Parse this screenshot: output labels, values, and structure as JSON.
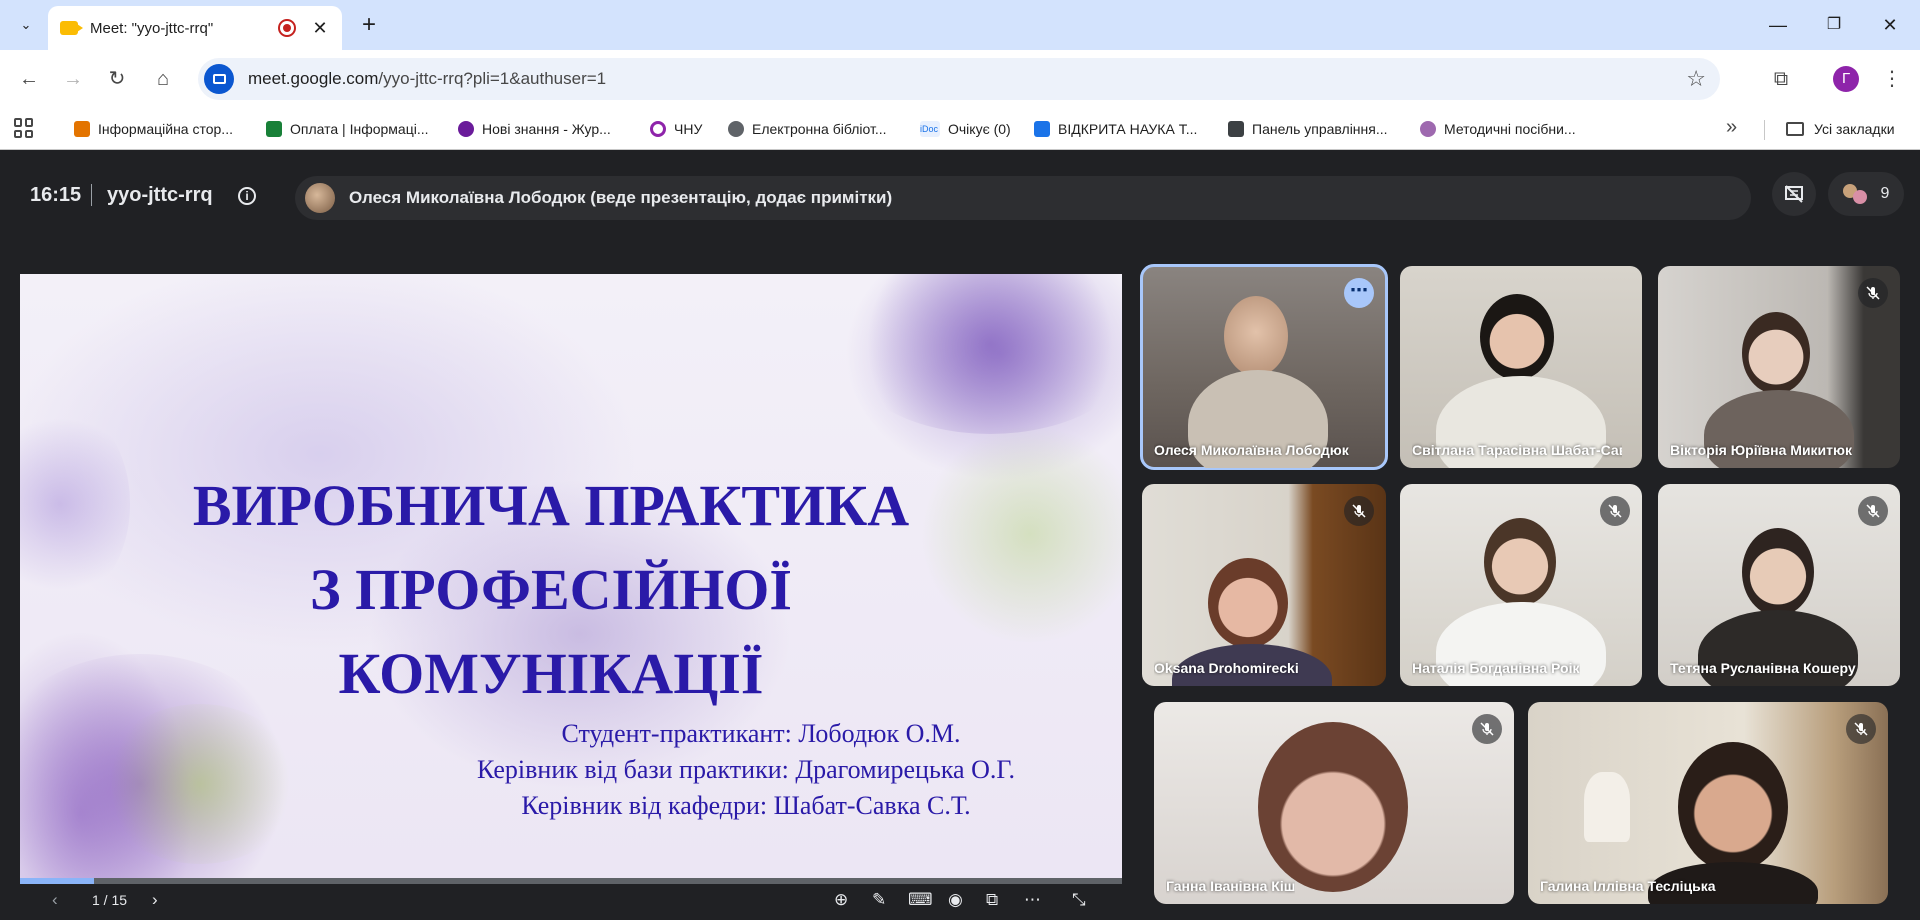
{
  "browser": {
    "tab": {
      "title": "Meet: \"yyo-jttc-rrq\""
    },
    "url": {
      "domain": "meet.google.com",
      "path": "/yyo-jttc-rrq?pli=1&authuser=1"
    },
    "profile_initial": "Г",
    "bookmarks": [
      {
        "label": "Інформаційна стор...",
        "color": "#e37400"
      },
      {
        "label": "Оплата | Інформаці...",
        "color": "#188038"
      },
      {
        "label": "Нові знання - Жур...",
        "color": "#6a1b9a"
      },
      {
        "label": "ЧНУ",
        "color": "#8e24aa"
      },
      {
        "label": "Електронна бібліот...",
        "color": "#5f6368"
      },
      {
        "label": "Очікує (0)",
        "color": "#1a73e8"
      },
      {
        "label": "ВІДКРИТА НАУКА Т...",
        "color": "#1a73e8"
      },
      {
        "label": "Панель управління...",
        "color": "#3c4043"
      },
      {
        "label": "Методичні посібни...",
        "color": "#9e69af"
      }
    ],
    "all_bookmarks": "Усі закладки"
  },
  "meet": {
    "time": "16:15",
    "code": "yyo-jttc-rrq",
    "presenter_status": "Олеся Миколаївна Лободюк (веде презентацію, додає примітки)",
    "participant_count": "9",
    "slide": {
      "title_lines": [
        "ВИРОБНИЧА ПРАКТИКА",
        "З ПРОФЕСІЙНОЇ",
        "КОМУНІКАЦІЇ"
      ],
      "credits": [
        "Студент-практикант: Лободюк О.М.",
        "Керівник від бази практики: Драгомирецька О.Г.",
        "Керівник від кафедри: Шабат-Савка С.Т."
      ],
      "page_indicator": "1 / 15",
      "progress": 0.0667
    },
    "participants": [
      {
        "name": "Олеся Миколаївна Лободюк",
        "muted": false,
        "active": true
      },
      {
        "name": "Світлана Тарасівна Шабат-Савка",
        "muted": false,
        "active": false
      },
      {
        "name": "Вікторія Юріївна Микитюк",
        "muted": true,
        "active": false
      },
      {
        "name": "Oksana Drohomirecki",
        "muted": true,
        "active": false
      },
      {
        "name": "Наталія Богданівна Роік",
        "muted": true,
        "active": false
      },
      {
        "name": "Тетяна Русланівна Кошеру",
        "muted": true,
        "active": false
      },
      {
        "name": "Ганна Іванівна Кіш",
        "muted": true,
        "active": false
      },
      {
        "name": "Галина Іллівна Тесліцька",
        "muted": true,
        "active": false
      }
    ]
  }
}
